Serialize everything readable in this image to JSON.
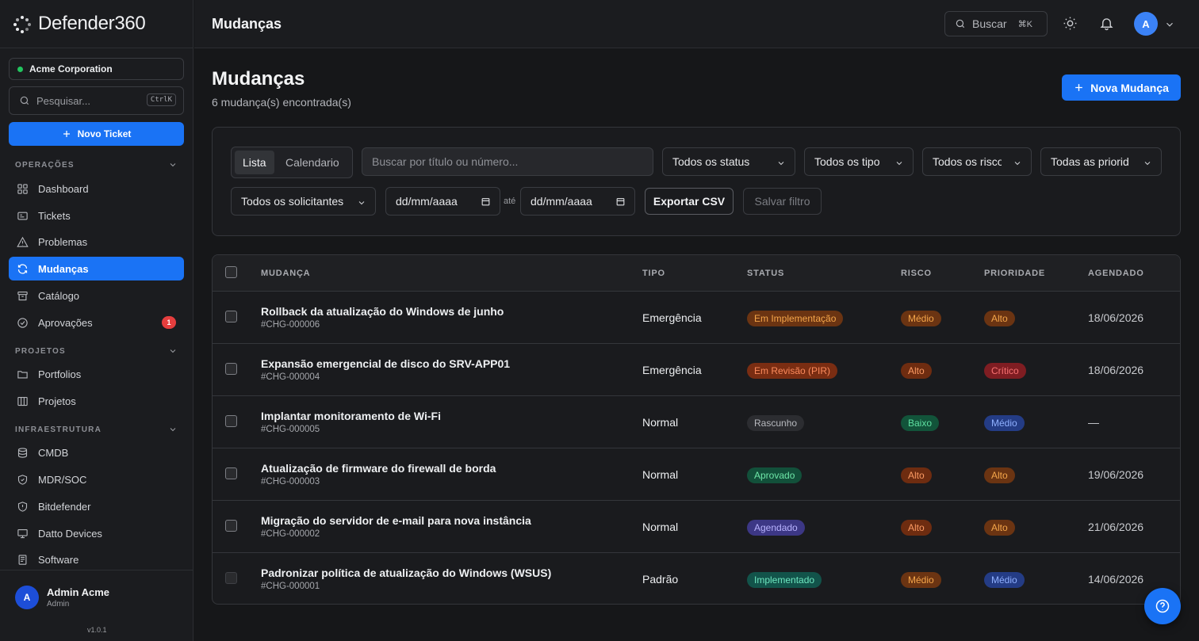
{
  "brand": {
    "name": "Defender360"
  },
  "sidebar": {
    "org": "Acme Corporation",
    "search_placeholder": "Pesquisar...",
    "search_shortcut": "CtrlK",
    "new_ticket": "Novo Ticket",
    "sections": [
      {
        "title": "OPERAÇÕES"
      },
      {
        "title": "PROJETOS"
      },
      {
        "title": "INFRAESTRUTURA"
      }
    ],
    "items": [
      {
        "label": "Dashboard",
        "icon": "dashboard-icon"
      },
      {
        "label": "Tickets",
        "icon": "ticket-icon"
      },
      {
        "label": "Problemas",
        "icon": "warning-icon"
      },
      {
        "label": "Mudanças",
        "icon": "refresh-icon",
        "active": true
      },
      {
        "label": "Catálogo",
        "icon": "archive-icon"
      },
      {
        "label": "Aprovações",
        "icon": "check-circle-icon",
        "badge": "1"
      },
      {
        "label": "Portfolios",
        "icon": "folder-icon"
      },
      {
        "label": "Projetos",
        "icon": "columns-icon"
      },
      {
        "label": "CMDB",
        "icon": "database-icon"
      },
      {
        "label": "MDR/SOC",
        "icon": "shield-check-icon"
      },
      {
        "label": "Bitdefender",
        "icon": "shield-icon"
      },
      {
        "label": "Datto Devices",
        "icon": "monitor-icon"
      },
      {
        "label": "Software",
        "icon": "package-icon"
      }
    ],
    "user": {
      "initial": "A",
      "name": "Admin Acme",
      "role": "Admin"
    },
    "version": "v1.0.1"
  },
  "topbar": {
    "title": "Mudanças",
    "search_label": "Buscar",
    "search_shortcut": "⌘K",
    "avatar_initial": "A"
  },
  "page": {
    "title": "Mudanças",
    "subtitle": "6 mudança(s) encontrada(s)",
    "new_button": "Nova Mudança"
  },
  "filters": {
    "view_tabs": [
      "Lista",
      "Calendario"
    ],
    "search_placeholder": "Buscar por título ou número...",
    "status": "Todos os status",
    "tipo": "Todos os tipo",
    "risco": "Todos os risco",
    "prioridade": "Todas as priorid",
    "solicitantes": "Todos os solicitantes",
    "date_from": "dd/mm/aaaa",
    "date_sep": "até",
    "date_to": "dd/mm/aaaa",
    "export": "Exportar CSV",
    "save_filter": "Salvar filtro"
  },
  "table": {
    "headers": [
      "MUDANÇA",
      "TIPO",
      "STATUS",
      "RISCO",
      "PRIORIDADE",
      "AGENDADO"
    ],
    "rows": [
      {
        "title": "Rollback da atualização do Windows de junho",
        "id": "#CHG-000006",
        "tipo": "Emergência",
        "status": "Em Implementação",
        "risco": "Médio",
        "prioridade": "Alto",
        "agendado": "18/06/2026"
      },
      {
        "title": "Expansão emergencial de disco do SRV-APP01",
        "id": "#CHG-000004",
        "tipo": "Emergência",
        "status": "Em Revisão (PIR)",
        "risco": "Alto",
        "prioridade": "Crítico",
        "agendado": "18/06/2026"
      },
      {
        "title": "Implantar monitoramento de Wi-Fi",
        "id": "#CHG-000005",
        "tipo": "Normal",
        "status": "Rascunho",
        "risco": "Baixo",
        "prioridade": "Médio",
        "agendado": "—"
      },
      {
        "title": "Atualização de firmware do firewall de borda",
        "id": "#CHG-000003",
        "tipo": "Normal",
        "status": "Aprovado",
        "risco": "Alto",
        "prioridade": "Alto",
        "agendado": "19/06/2026"
      },
      {
        "title": "Migração do servidor de e-mail para nova instância",
        "id": "#CHG-000002",
        "tipo": "Normal",
        "status": "Agendado",
        "risco": "Alto",
        "prioridade": "Alto",
        "agendado": "21/06/2026"
      },
      {
        "title": "Padronizar política de atualização do Windows (WSUS)",
        "id": "#CHG-000001",
        "tipo": "Padrão",
        "status": "Implementado",
        "risco": "Médio",
        "prioridade": "Médio",
        "agendado": "14/06/2026"
      }
    ]
  },
  "colors": {
    "accent": "#1a73f5",
    "status_em_implementacao": "#7c3a12",
    "status_em_revisao": "#8a2f14",
    "status_rascunho": "#2d2e32",
    "status_aprovado": "#14533a",
    "status_agendado": "#3f3a8c",
    "status_implementado": "#155348",
    "risk_medio": "#7a3a10",
    "risk_alto": "#7a2f12",
    "risk_baixo": "#145c3e",
    "priority_alto": "#7a3a10",
    "priority_critico": "#8c1f24",
    "priority_medio": "#283f8a"
  }
}
